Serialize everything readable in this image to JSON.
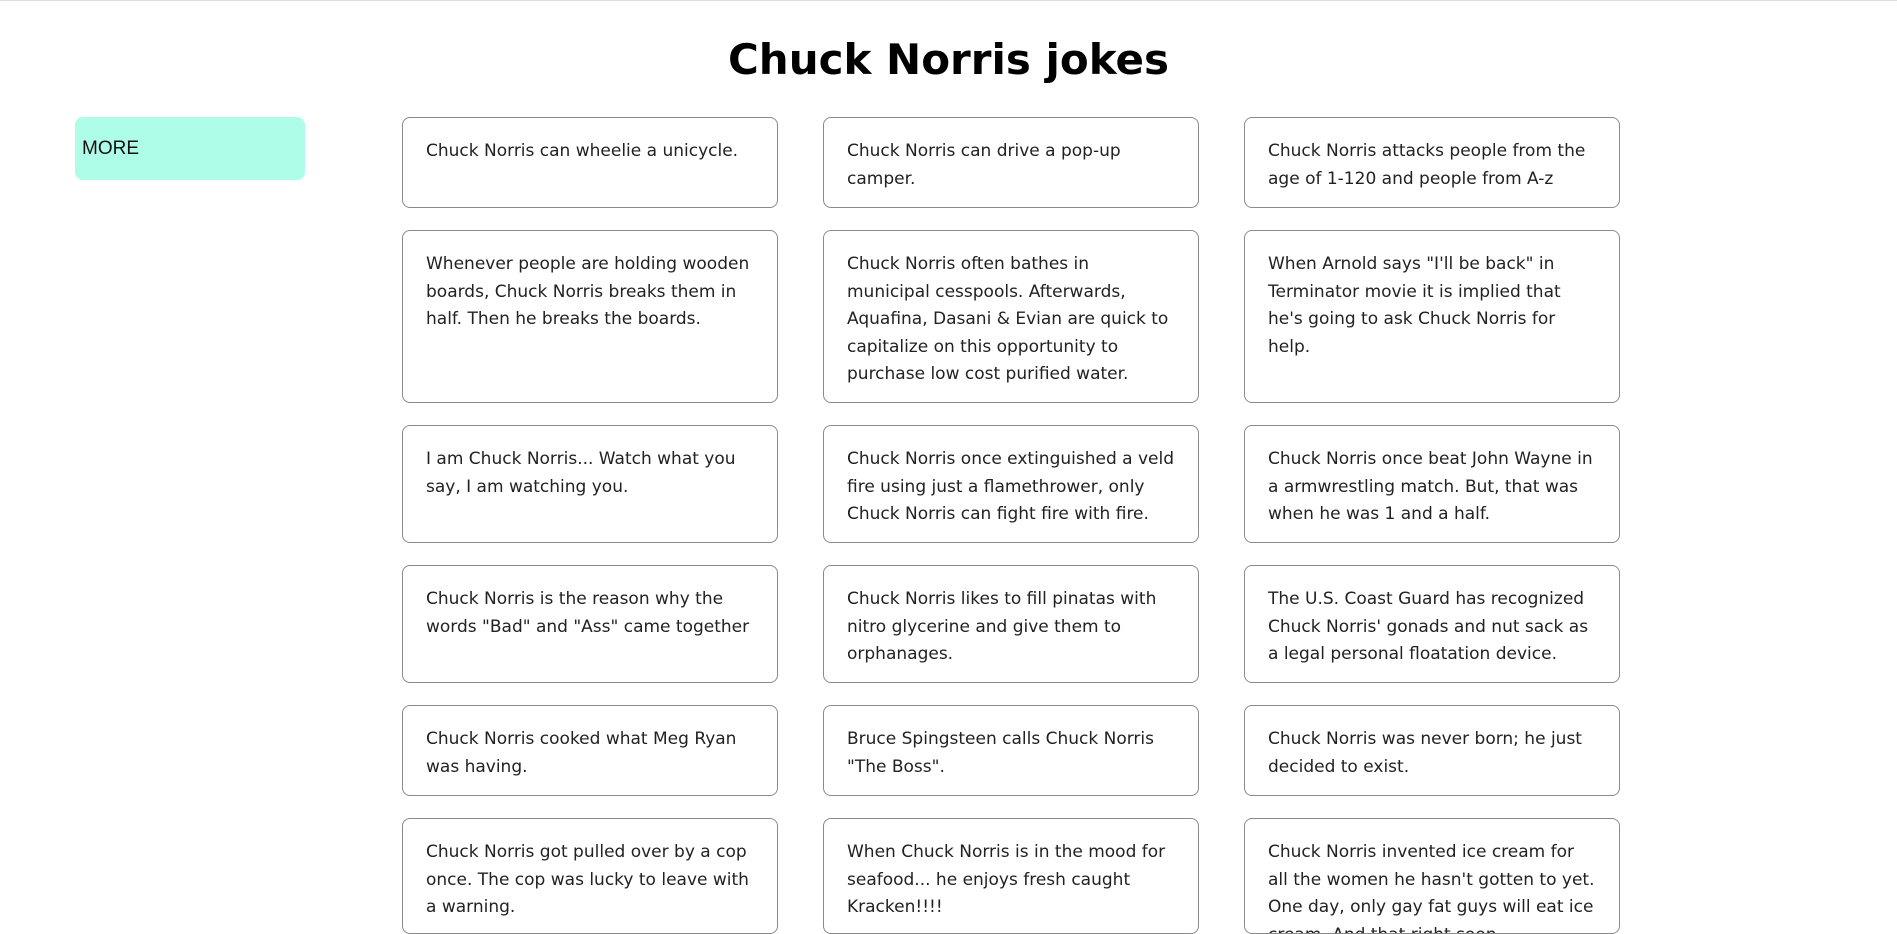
{
  "page": {
    "title": "Chuck Norris jokes"
  },
  "sidebar": {
    "more_label": "MORE",
    "more_color": "#adfde9"
  },
  "jokes": [
    "Chuck Norris can wheelie a unicycle.",
    "Chuck Norris can drive a pop-up camper.",
    "Chuck Norris attacks people from the age of 1-120 and people from A-z",
    "Whenever people are holding wooden boards, Chuck Norris breaks them in half. Then he breaks the boards.",
    "Chuck Norris often bathes in municipal cesspools. Afterwards, Aquafina, Dasani & Evian are quick to capitalize on this opportunity to purchase low cost purified water.",
    "When Arnold says \"I'll be back\" in Terminator movie it is implied that he's going to ask Chuck Norris for help.",
    "I am Chuck Norris... Watch what you say, I am watching you.",
    "Chuck Norris once extinguished a veld fire using just a flamethrower, only Chuck Norris can fight fire with fire.",
    "Chuck Norris once beat John Wayne in a armwrestling match. But, that was when he was 1 and a half.",
    "Chuck Norris is the reason why the words \"Bad\" and \"Ass\" came together",
    "Chuck Norris likes to fill pinatas with nitro glycerine and give them to orphanages.",
    "The U.S. Coast Guard has recognized Chuck Norris' gonads and nut sack as a legal personal floatation device.",
    "Chuck Norris cooked what Meg Ryan was having.",
    "Bruce Spingsteen calls Chuck Norris \"The Boss\".",
    "Chuck Norris was never born; he just decided to exist.",
    "Chuck Norris got pulled over by a cop once. The cop was lucky to leave with a warning.",
    "When Chuck Norris is in the mood for seafood... he enjoys fresh caught Kracken!!!!",
    "Chuck Norris invented ice cream for all the women he hasn't gotten to yet. One day, only gay fat guys will eat ice cream. And that right soon."
  ]
}
